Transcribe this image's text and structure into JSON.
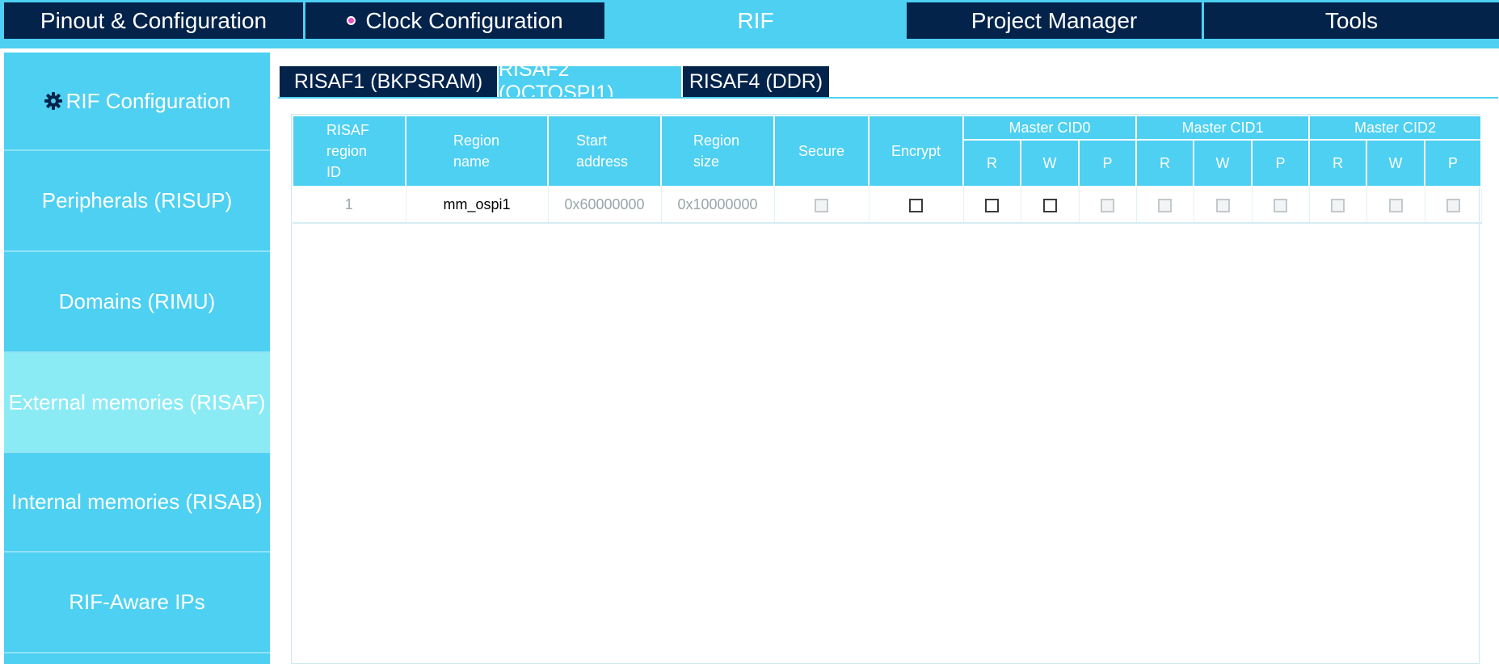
{
  "topnav": {
    "tabs": [
      {
        "label": "Pinout & Configuration"
      },
      {
        "label": "Clock Configuration"
      },
      {
        "label": "RIF"
      },
      {
        "label": "Project Manager"
      },
      {
        "label": "Tools"
      }
    ],
    "active_tab": "RIF"
  },
  "sidebar": {
    "items": [
      {
        "label": "RIF Configuration",
        "icon": "gear-icon"
      },
      {
        "label": "Peripherals (RISUP)"
      },
      {
        "label": "Domains (RIMU)"
      },
      {
        "label": "External memories (RISAF)"
      },
      {
        "label": "Internal memories (RISAB)"
      },
      {
        "label": "RIF-Aware IPs"
      }
    ],
    "active_item": "External memories (RISAF)"
  },
  "subtabs": {
    "items": [
      {
        "label": "RISAF1 (BKPSRAM)"
      },
      {
        "label": "RISAF2 (OCTOSPI1)"
      },
      {
        "label": "RISAF4 (DDR)"
      }
    ],
    "active_item": "RISAF2 (OCTOSPI1)"
  },
  "table": {
    "headers": {
      "region_id": [
        "RISAF",
        "region",
        "ID"
      ],
      "region_name": [
        "Region",
        "name"
      ],
      "start_address": [
        "Start",
        "address"
      ],
      "region_size": [
        "Region",
        "size"
      ],
      "secure": "Secure",
      "encrypt": "Encrypt",
      "master_cid0": "Master CID0",
      "master_cid1": "Master CID1",
      "master_cid2": "Master CID2",
      "r": "R",
      "w": "W",
      "p": "P"
    },
    "rows": [
      {
        "id": "1",
        "name": "mm_ospi1",
        "start": "0x60000000",
        "size": "0x10000000",
        "secure": {
          "checked": false,
          "enabled": false
        },
        "encrypt": {
          "checked": false,
          "enabled": true
        },
        "cid0": {
          "r": {
            "checked": false,
            "enabled": true
          },
          "w": {
            "checked": false,
            "enabled": true
          },
          "p": {
            "checked": false,
            "enabled": false
          }
        },
        "cid1": {
          "r": {
            "checked": false,
            "enabled": false
          },
          "w": {
            "checked": false,
            "enabled": false
          },
          "p": {
            "checked": false,
            "enabled": false
          }
        },
        "cid2": {
          "r": {
            "checked": false,
            "enabled": false
          },
          "w": {
            "checked": false,
            "enabled": false
          },
          "p": {
            "checked": false,
            "enabled": false
          }
        }
      }
    ]
  },
  "colors": {
    "navy": "#03234b",
    "cyan": "#4dd0f2",
    "active_sidebar": "#8aebf5",
    "clock_dot": "#e64ecc"
  }
}
